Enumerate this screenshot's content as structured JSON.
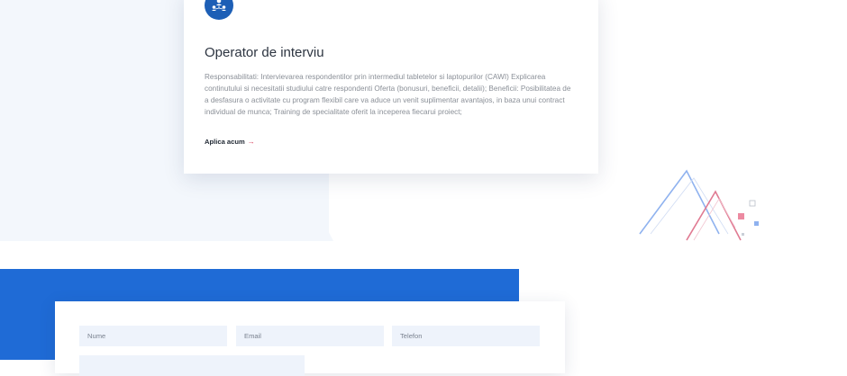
{
  "job": {
    "title": "Operator de interviu",
    "description": "Responsabilitati: Intervievarea respondentilor prin intermediul tabletelor si laptopurilor (CAWI) Explicarea continutului si necesitatii studiului catre respondenti Oferta (bonusuri, beneficii, detalii); Beneficii: Posibilitatea de a desfasura o activitate cu program flexibil care va aduce un venit suplimentar avantajos, in baza unui contract individual de munca; Training de specialitate oferit la inceperea fiecarui proiect;",
    "apply_label": "Aplica acum",
    "apply_arrow": "→",
    "icon": "team-icon"
  },
  "form": {
    "name_placeholder": "Nume",
    "email_placeholder": "Email",
    "phone_placeholder": "Telefon"
  },
  "colors": {
    "accent_blue": "#1f6bd6",
    "icon_blue": "#1d5fb6",
    "accent_pink": "#d83c5a",
    "field_bg": "#eef3fb"
  }
}
